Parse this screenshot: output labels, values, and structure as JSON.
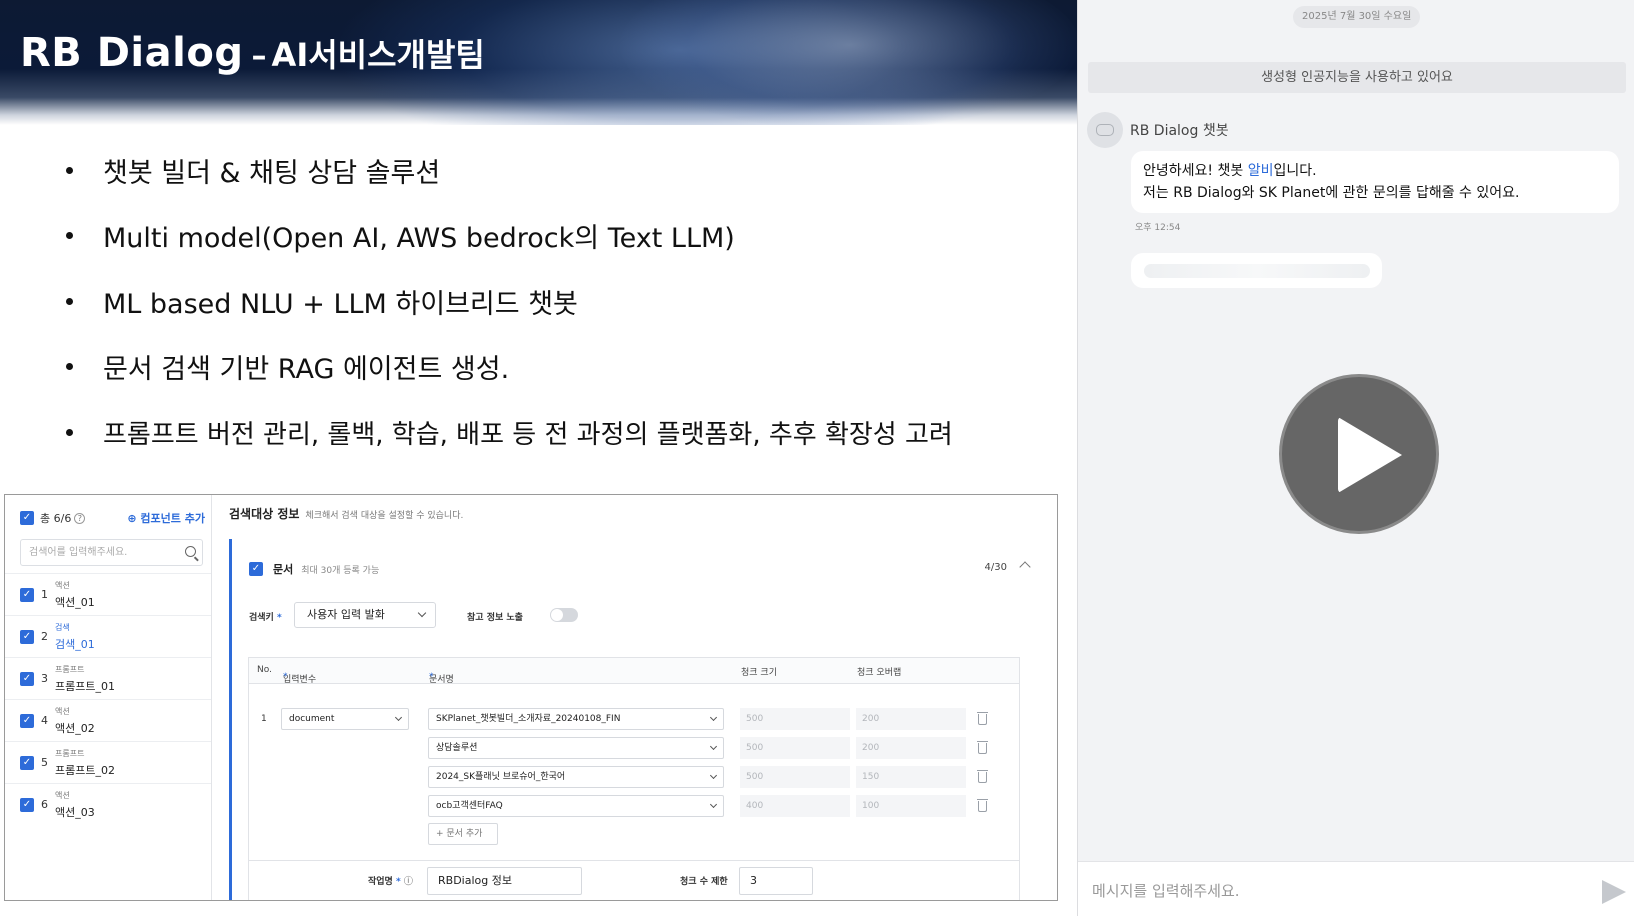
{
  "slide": {
    "title_main": "RB Dialog",
    "title_dash": "–",
    "title_team": "AI서비스개발팀",
    "bullets": [
      "챗봇 빌더 & 채팅 상담 솔루션",
      "Multi model(Open AI, AWS bedrock의 Text LLM)",
      "ML based NLU + LLM 하이브리드 챗봇",
      "문서 검색 기반 RAG 에이전트 생성.",
      "프롬프트 버전 관리, 롤백, 학습, 배포 등 전 과정의 플랫폼화, 추후 확장성 고려"
    ]
  },
  "builder": {
    "component_panel": {
      "total": "총 6/6",
      "add_label": "⊕ 컴포넌트 추가",
      "search_placeholder": "검색어를 입력해주세요.",
      "items": [
        {
          "num": "1",
          "type": "액션",
          "name": "액션_01"
        },
        {
          "num": "2",
          "type": "검색",
          "name": "검색_01"
        },
        {
          "num": "3",
          "type": "프롬프트",
          "name": "프롬프트_01"
        },
        {
          "num": "4",
          "type": "액션",
          "name": "액션_02"
        },
        {
          "num": "5",
          "type": "프롬프트",
          "name": "프롬프트_02"
        },
        {
          "num": "6",
          "type": "액션",
          "name": "액션_03"
        }
      ]
    },
    "detail": {
      "title": "검색대상 정보",
      "subtitle": "체크해서 검색 대상을 설정할 수 있습니다.",
      "doc_label": "문서",
      "doc_sub": "최대 30개 등록 가능",
      "doc_count": "4/30",
      "search_key_label": "검색키",
      "search_key_value": "사용자 입력 발화",
      "ref_info_label": "참고 정보 노출",
      "table_headers": {
        "no": "No.",
        "input_var": "입력변수",
        "doc_name": "문서명",
        "chunk_size": "청크 크기",
        "chunk_overlap": "청크 오버랩"
      },
      "row_no": "1",
      "input_var_value": "document",
      "docs": [
        {
          "name": "SKPlanet_챗봇빌더_소개자료_20240108_FIN",
          "chunk_size": "500",
          "chunk_overlap": "200"
        },
        {
          "name": "상담솔루션",
          "chunk_size": "500",
          "chunk_overlap": "200"
        },
        {
          "name": "2024_SK플래닛 브로슈어_한국어",
          "chunk_size": "500",
          "chunk_overlap": "150"
        },
        {
          "name": "ocb고객센터FAQ",
          "chunk_size": "400",
          "chunk_overlap": "100"
        }
      ],
      "add_doc_label": "+ 문서 추가",
      "task_name_label": "작업명",
      "task_name_value": "RBDialog 정보",
      "chunk_limit_label": "청크 수 제한",
      "chunk_limit_value": "3"
    }
  },
  "chat": {
    "date": "2025년 7월 30일 수요일",
    "notice": "생성형 인공지능을 사용하고 있어요",
    "bot_name": "RB Dialog 챗봇",
    "greeting_pre": "안녕하세요! 챗봇 ",
    "greeting_highlight": "알비",
    "greeting_post": "입니다.",
    "greeting_line2": "저는 RB Dialog와 SK Planet에 관한 문의를 답해줄 수 있어요.",
    "time": "오후 12:54",
    "input_placeholder": "메시지를 입력해주세요."
  },
  "colors": {
    "accent": "#2d6bd9",
    "header_dark": "#0d1a33",
    "chat_bg": "#f2f3f5"
  },
  "icons": [
    "check-icon",
    "help-icon",
    "search-icon",
    "chevron-down-icon",
    "chevron-up-icon",
    "trash-icon",
    "bot-icon",
    "play-icon",
    "send-icon"
  ]
}
